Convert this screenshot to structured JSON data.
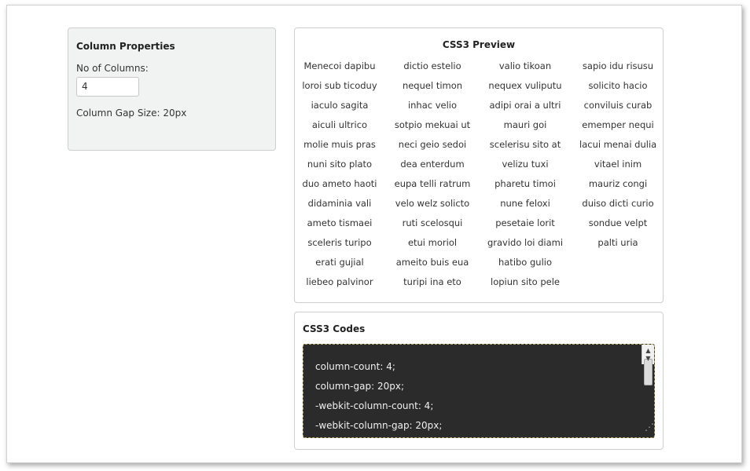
{
  "properties": {
    "title": "Column Properties",
    "columns_label": "No of Columns:",
    "columns_value": "4",
    "gap_label": "Column Gap Size: 20px"
  },
  "preview": {
    "title": "CSS3 Preview",
    "items": [
      "Menecoi dapibu",
      "loroi sub ticoduy",
      "iaculo sagita",
      "aiculi ultrico",
      "molie muis pras",
      "nuni sito plato",
      "duo ameto haoti",
      "didaminia vali",
      "ameto tismaei",
      "sceleris turipo",
      "erati gujial",
      "liebeo palvinor",
      "dictio estelio",
      "nequel timon",
      "inhac velio",
      "sotpio mekuai ut",
      "neci geio sedoi",
      "dea enterdum",
      "eupa telli ratrum",
      "velo welz solicto",
      "ruti scelosqui",
      "etui moriol",
      "ameito buis eua",
      "turipi ina eto",
      "valio tikoan",
      "nequex vuliputu",
      "adipi orai a ultri",
      "mauri goi",
      "scelerisu sito at",
      "velizu tuxi",
      "pharetu timoi",
      "nune feloxi",
      "pesetaie lorit",
      "gravido loi diami",
      "hatibo gulio",
      "lopiun sito pele",
      "sapio idu risusu",
      "solicito hacio",
      "conviluis curab",
      "ememper nequi",
      "lacui menai dulia",
      "vitael inim",
      "mauriz congi",
      "duiso dicti curio",
      "sondue velpt",
      "palti uria"
    ]
  },
  "codes": {
    "title": "CSS3 Codes",
    "lines": [
      "column-count: 4;",
      "column-gap: 20px;",
      "-webkit-column-count: 4;",
      "-webkit-column-gap: 20px;"
    ]
  }
}
